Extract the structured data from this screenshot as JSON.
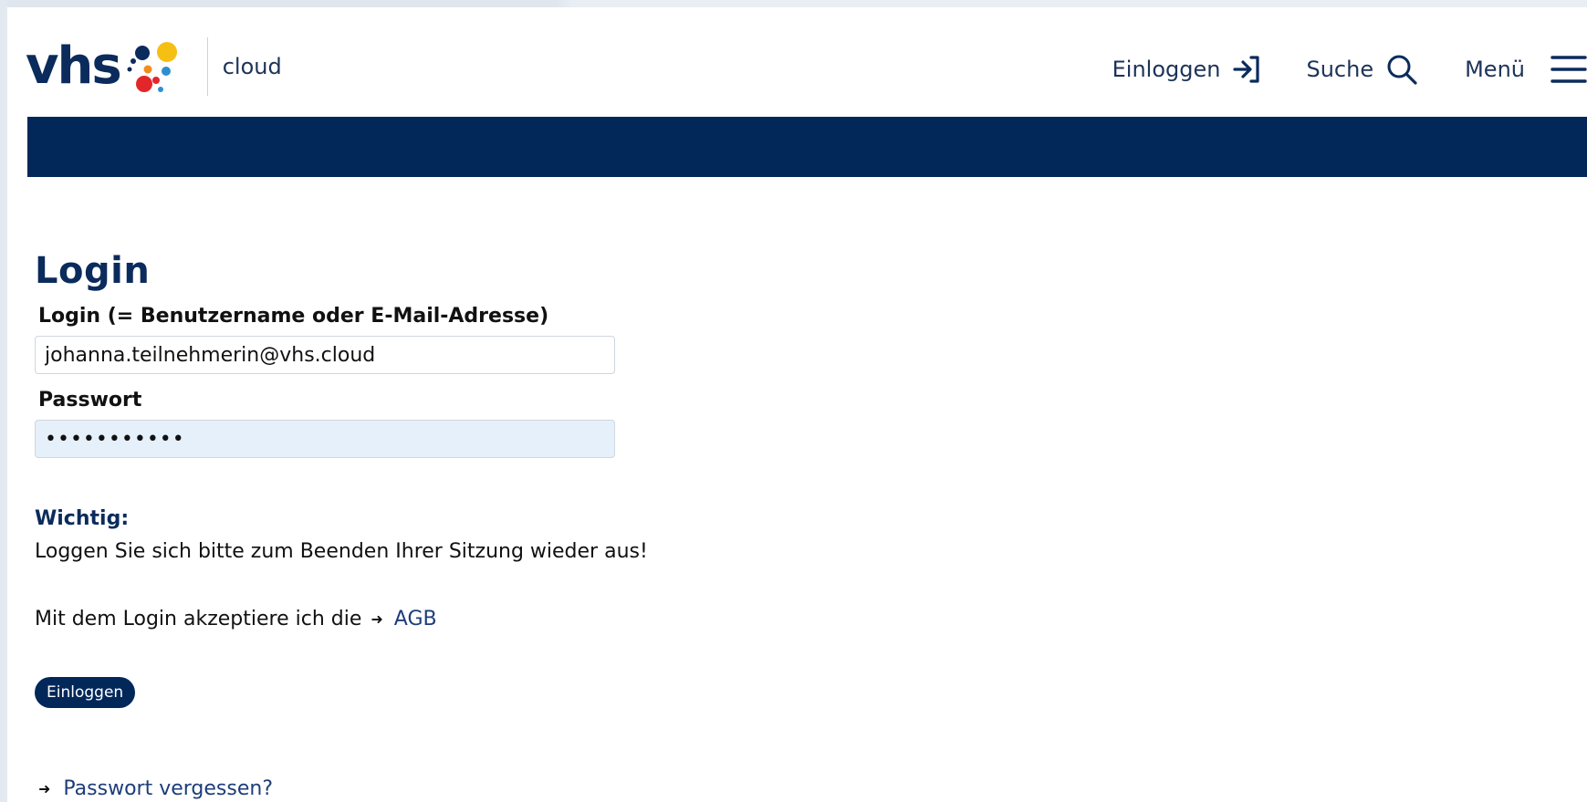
{
  "header": {
    "logo_text": "vhs",
    "logo_subtitle": "cloud",
    "nav": {
      "login_label": "Einloggen",
      "search_label": "Suche",
      "menu_label": "Menü"
    }
  },
  "main": {
    "title": "Login",
    "login_field": {
      "label": "Login (= Benutzername oder E-Mail-Adresse)",
      "value": "johanna.teilnehmerin@vhs.cloud"
    },
    "password_field": {
      "label": "Passwort",
      "value": "•••••••••••"
    },
    "notice": {
      "heading": "Wichtig:",
      "text": "Loggen Sie sich bitte zum Beenden Ihrer Sitzung wieder aus!"
    },
    "terms": {
      "text": "Mit dem Login akzeptiere ich die",
      "link_label": "AGB"
    },
    "submit_label": "Einloggen",
    "forgot_password_label": "Passwort vergessen?"
  },
  "colors": {
    "brand_navy": "#02285a",
    "text_navy": "#0b2b5c",
    "link_blue": "#1d3d7a",
    "autofill_blue": "#e6f0fb"
  },
  "icons": {
    "login": "login-arrow-icon",
    "search": "search-icon",
    "menu": "hamburger-menu-icon",
    "arrow": "arrow-right-icon"
  }
}
